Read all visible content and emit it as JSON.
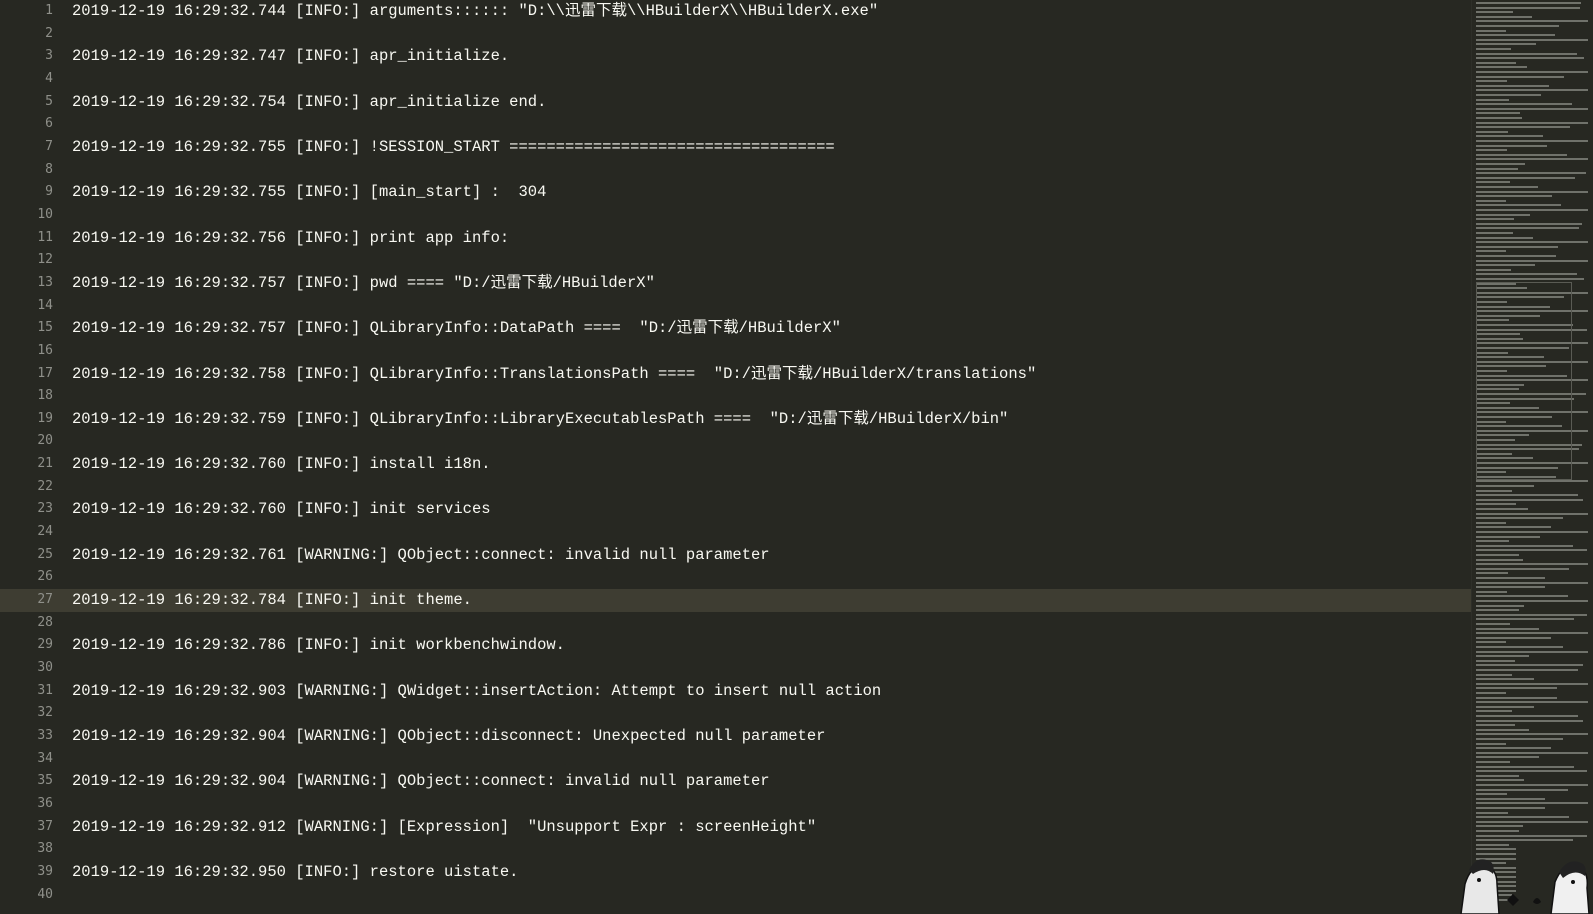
{
  "editor": {
    "current_line": 27,
    "lines": [
      {
        "n": "1",
        "text": "2019-12-19 16:29:32.744 [INFO:] arguments:::::: \"D:\\\\迅雷下载\\\\HBuilderX\\\\HBuilderX.exe\""
      },
      {
        "n": "2",
        "text": ""
      },
      {
        "n": "3",
        "text": "2019-12-19 16:29:32.747 [INFO:] apr_initialize."
      },
      {
        "n": "4",
        "text": ""
      },
      {
        "n": "5",
        "text": "2019-12-19 16:29:32.754 [INFO:] apr_initialize end."
      },
      {
        "n": "6",
        "text": ""
      },
      {
        "n": "7",
        "text": "2019-12-19 16:29:32.755 [INFO:] !SESSION_START ==================================="
      },
      {
        "n": "8",
        "text": ""
      },
      {
        "n": "9",
        "text": "2019-12-19 16:29:32.755 [INFO:] [main_start] :  304"
      },
      {
        "n": "10",
        "text": ""
      },
      {
        "n": "11",
        "text": "2019-12-19 16:29:32.756 [INFO:] print app info:"
      },
      {
        "n": "12",
        "text": ""
      },
      {
        "n": "13",
        "text": "2019-12-19 16:29:32.757 [INFO:] pwd ==== \"D:/迅雷下载/HBuilderX\""
      },
      {
        "n": "14",
        "text": ""
      },
      {
        "n": "15",
        "text": "2019-12-19 16:29:32.757 [INFO:] QLibraryInfo::DataPath ====  \"D:/迅雷下载/HBuilderX\""
      },
      {
        "n": "16",
        "text": ""
      },
      {
        "n": "17",
        "text": "2019-12-19 16:29:32.758 [INFO:] QLibraryInfo::TranslationsPath ====  \"D:/迅雷下载/HBuilderX/translations\""
      },
      {
        "n": "18",
        "text": ""
      },
      {
        "n": "19",
        "text": "2019-12-19 16:29:32.759 [INFO:] QLibraryInfo::LibraryExecutablesPath ====  \"D:/迅雷下载/HBuilderX/bin\""
      },
      {
        "n": "20",
        "text": ""
      },
      {
        "n": "21",
        "text": "2019-12-19 16:29:32.760 [INFO:] install i18n."
      },
      {
        "n": "22",
        "text": ""
      },
      {
        "n": "23",
        "text": "2019-12-19 16:29:32.760 [INFO:] init services"
      },
      {
        "n": "24",
        "text": ""
      },
      {
        "n": "25",
        "text": "2019-12-19 16:29:32.761 [WARNING:] QObject::connect: invalid null parameter"
      },
      {
        "n": "26",
        "text": ""
      },
      {
        "n": "27",
        "text": "2019-12-19 16:29:32.784 [INFO:] init theme."
      },
      {
        "n": "28",
        "text": ""
      },
      {
        "n": "29",
        "text": "2019-12-19 16:29:32.786 [INFO:] init workbenchwindow."
      },
      {
        "n": "30",
        "text": ""
      },
      {
        "n": "31",
        "text": "2019-12-19 16:29:32.903 [WARNING:] QWidget::insertAction: Attempt to insert null action"
      },
      {
        "n": "32",
        "text": ""
      },
      {
        "n": "33",
        "text": "2019-12-19 16:29:32.904 [WARNING:] QObject::disconnect: Unexpected null parameter"
      },
      {
        "n": "34",
        "text": ""
      },
      {
        "n": "35",
        "text": "2019-12-19 16:29:32.904 [WARNING:] QObject::connect: invalid null parameter"
      },
      {
        "n": "36",
        "text": ""
      },
      {
        "n": "37",
        "text": "2019-12-19 16:29:32.912 [WARNING:] [Expression]  \"Unsupport Expr : screenHeight\""
      },
      {
        "n": "38",
        "text": ""
      },
      {
        "n": "39",
        "text": "2019-12-19 16:29:32.950 [INFO:] restore uistate."
      },
      {
        "n": "40",
        "text": ""
      }
    ]
  },
  "colors": {
    "background": "#272822",
    "text": "#f8f8f2",
    "line_number": "#8f908a",
    "current_line_bg": "#3e3d32"
  },
  "icons": {
    "minimap_mascot": "mascot-illustration-icon"
  }
}
